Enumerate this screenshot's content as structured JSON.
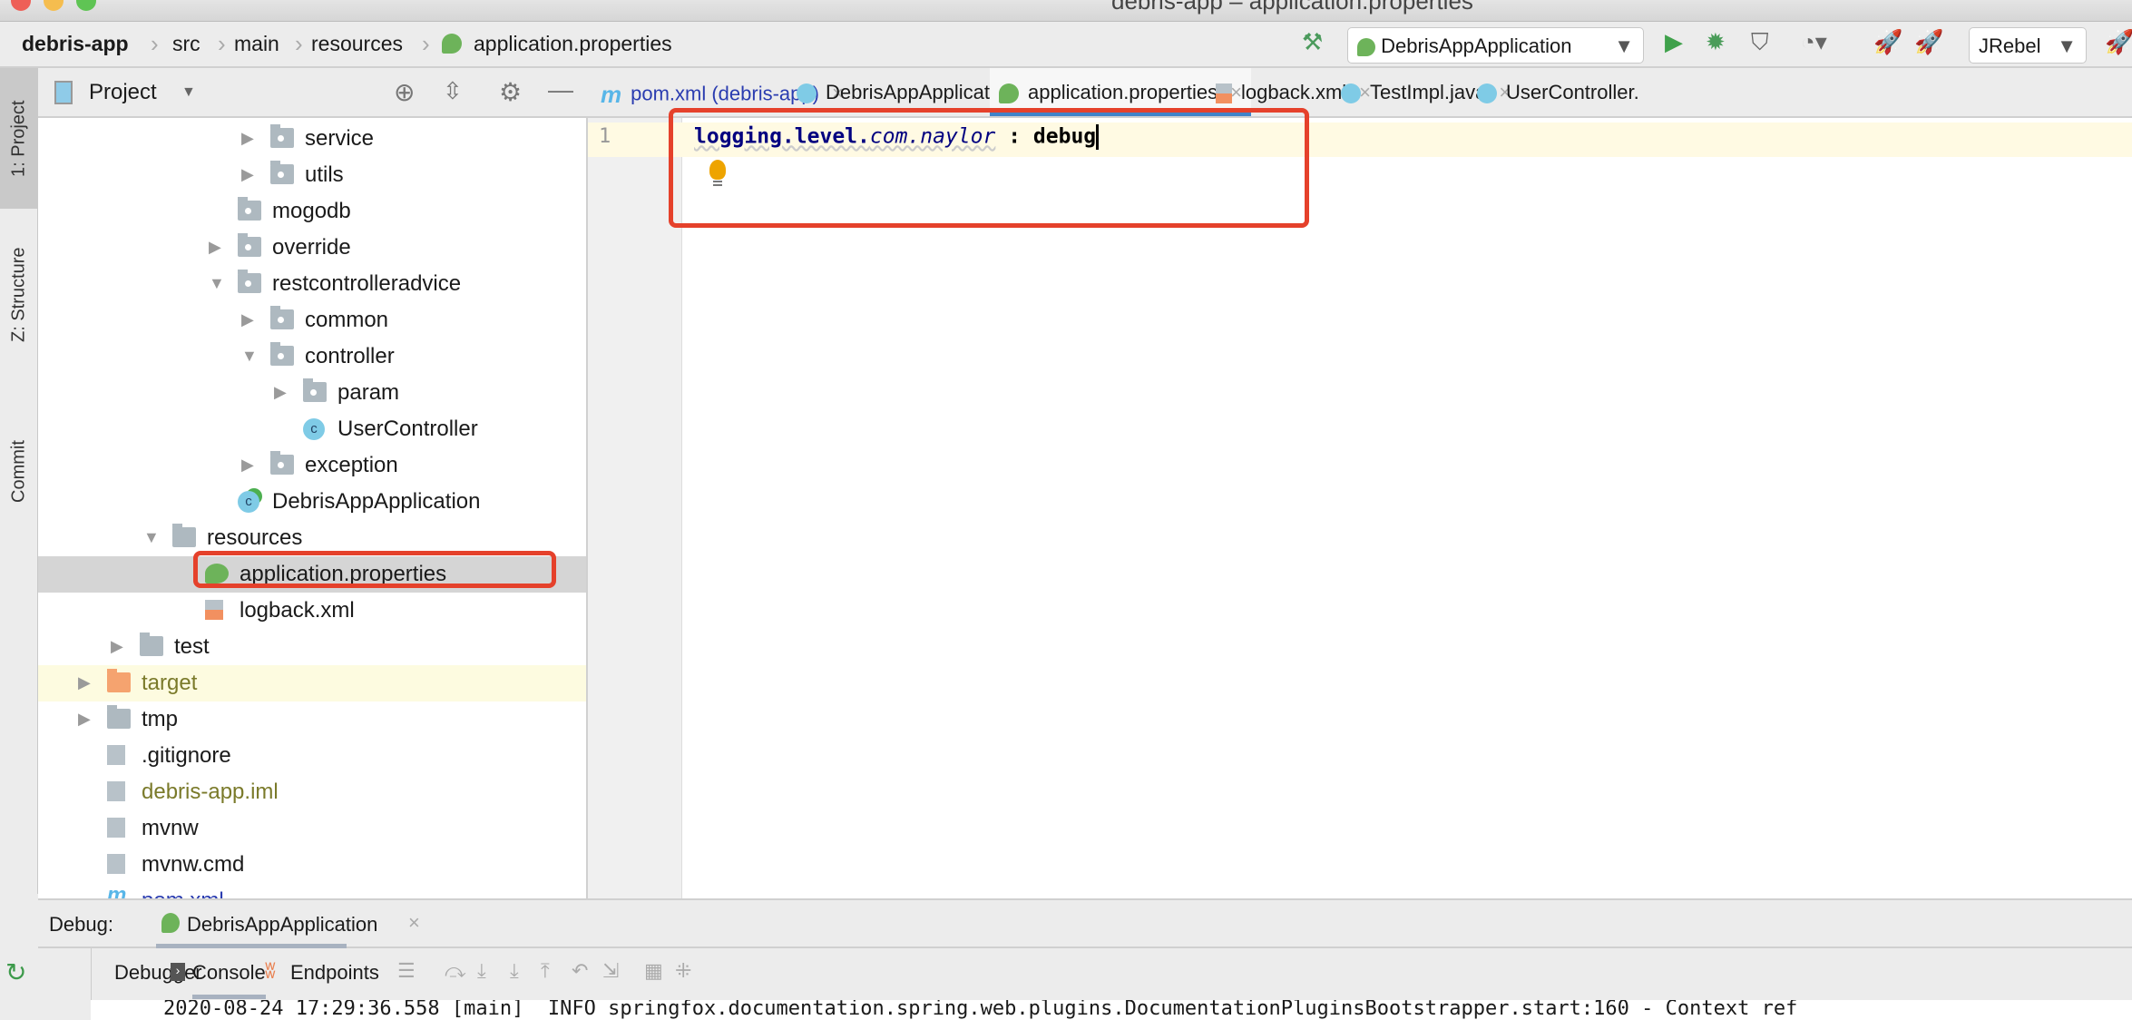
{
  "window": {
    "title": "debris-app – application.properties"
  },
  "breadcrumb": [
    "debris-app",
    "src",
    "main",
    "resources",
    "application.properties"
  ],
  "toolbar": {
    "run_config": "DebrisAppApplication",
    "jrebel": "JRebel"
  },
  "left_strip": {
    "project": "1: Project",
    "structure": "Z: Structure",
    "commit": "Commit"
  },
  "project_panel": {
    "title": "Project",
    "tree": [
      {
        "label": "service",
        "level": 5,
        "icon": "package",
        "arrow": "right"
      },
      {
        "label": "utils",
        "level": 5,
        "icon": "package",
        "arrow": "right"
      },
      {
        "label": "mogodb",
        "level": 4,
        "icon": "package",
        "arrow": ""
      },
      {
        "label": "override",
        "level": 4,
        "icon": "package",
        "arrow": "right"
      },
      {
        "label": "restcontrolleradvice",
        "level": 4,
        "icon": "package",
        "arrow": "down"
      },
      {
        "label": "common",
        "level": 5,
        "icon": "package",
        "arrow": "right"
      },
      {
        "label": "controller",
        "level": 5,
        "icon": "package",
        "arrow": "down"
      },
      {
        "label": "param",
        "level": 6,
        "icon": "package",
        "arrow": "right"
      },
      {
        "label": "UserController",
        "level": 6,
        "icon": "class",
        "arrow": ""
      },
      {
        "label": "exception",
        "level": 5,
        "icon": "package",
        "arrow": "right"
      },
      {
        "label": "DebrisAppApplication",
        "level": 4,
        "icon": "spring-class",
        "arrow": ""
      },
      {
        "label": "resources",
        "level": 2,
        "icon": "resources-folder",
        "arrow": "down"
      },
      {
        "label": "application.properties",
        "level": 3,
        "icon": "spring-properties",
        "arrow": "",
        "selected": true
      },
      {
        "label": "logback.xml",
        "level": 3,
        "icon": "xml-file",
        "arrow": ""
      },
      {
        "label": "test",
        "level": 1,
        "icon": "folder",
        "arrow": "right"
      },
      {
        "label": "target",
        "level": 0,
        "icon": "excluded-folder",
        "arrow": "right",
        "highlight": true
      },
      {
        "label": "tmp",
        "level": 0,
        "icon": "folder",
        "arrow": "right"
      },
      {
        "label": ".gitignore",
        "level": 0,
        "icon": "ignore-file",
        "arrow": ""
      },
      {
        "label": "debris-app.iml",
        "level": 0,
        "icon": "iml-file",
        "arrow": ""
      },
      {
        "label": "mvnw",
        "level": 0,
        "icon": "shell-file",
        "arrow": ""
      },
      {
        "label": "mvnw.cmd",
        "level": 0,
        "icon": "text-file",
        "arrow": ""
      },
      {
        "label": "pom.xml",
        "level": 0,
        "icon": "maven-file",
        "arrow": ""
      }
    ]
  },
  "tabs": [
    {
      "label": "pom.xml (debris-app)",
      "icon": "maven",
      "color": "#2a3cb0"
    },
    {
      "label": "DebrisAppApplication.java",
      "icon": "spring-class"
    },
    {
      "label": "application.properties",
      "icon": "spring-properties",
      "active": true
    },
    {
      "label": "logback.xml",
      "icon": "xml"
    },
    {
      "label": "TestImpl.java",
      "icon": "class"
    },
    {
      "label": "UserController.",
      "icon": "class"
    }
  ],
  "editor": {
    "line_number": "1",
    "key_part1": "logging.level.",
    "key_part2": "com.naylor",
    "separator": " : ",
    "value": "debug"
  },
  "debug": {
    "label": "Debug:",
    "session": "DebrisAppApplication",
    "tabs": [
      "Debugger",
      "Console",
      "Endpoints"
    ],
    "console_line": "2020-08-24 17:29:36.558 [main]  INFO springfox.documentation.spring.web.plugins.DocumentationPluginsBootstrapper.start:160 - Context ref"
  },
  "colors": {
    "highlight_box": "#e5412b",
    "active_tab_underline": "#4083c9",
    "selection": "#d5d5d5"
  }
}
